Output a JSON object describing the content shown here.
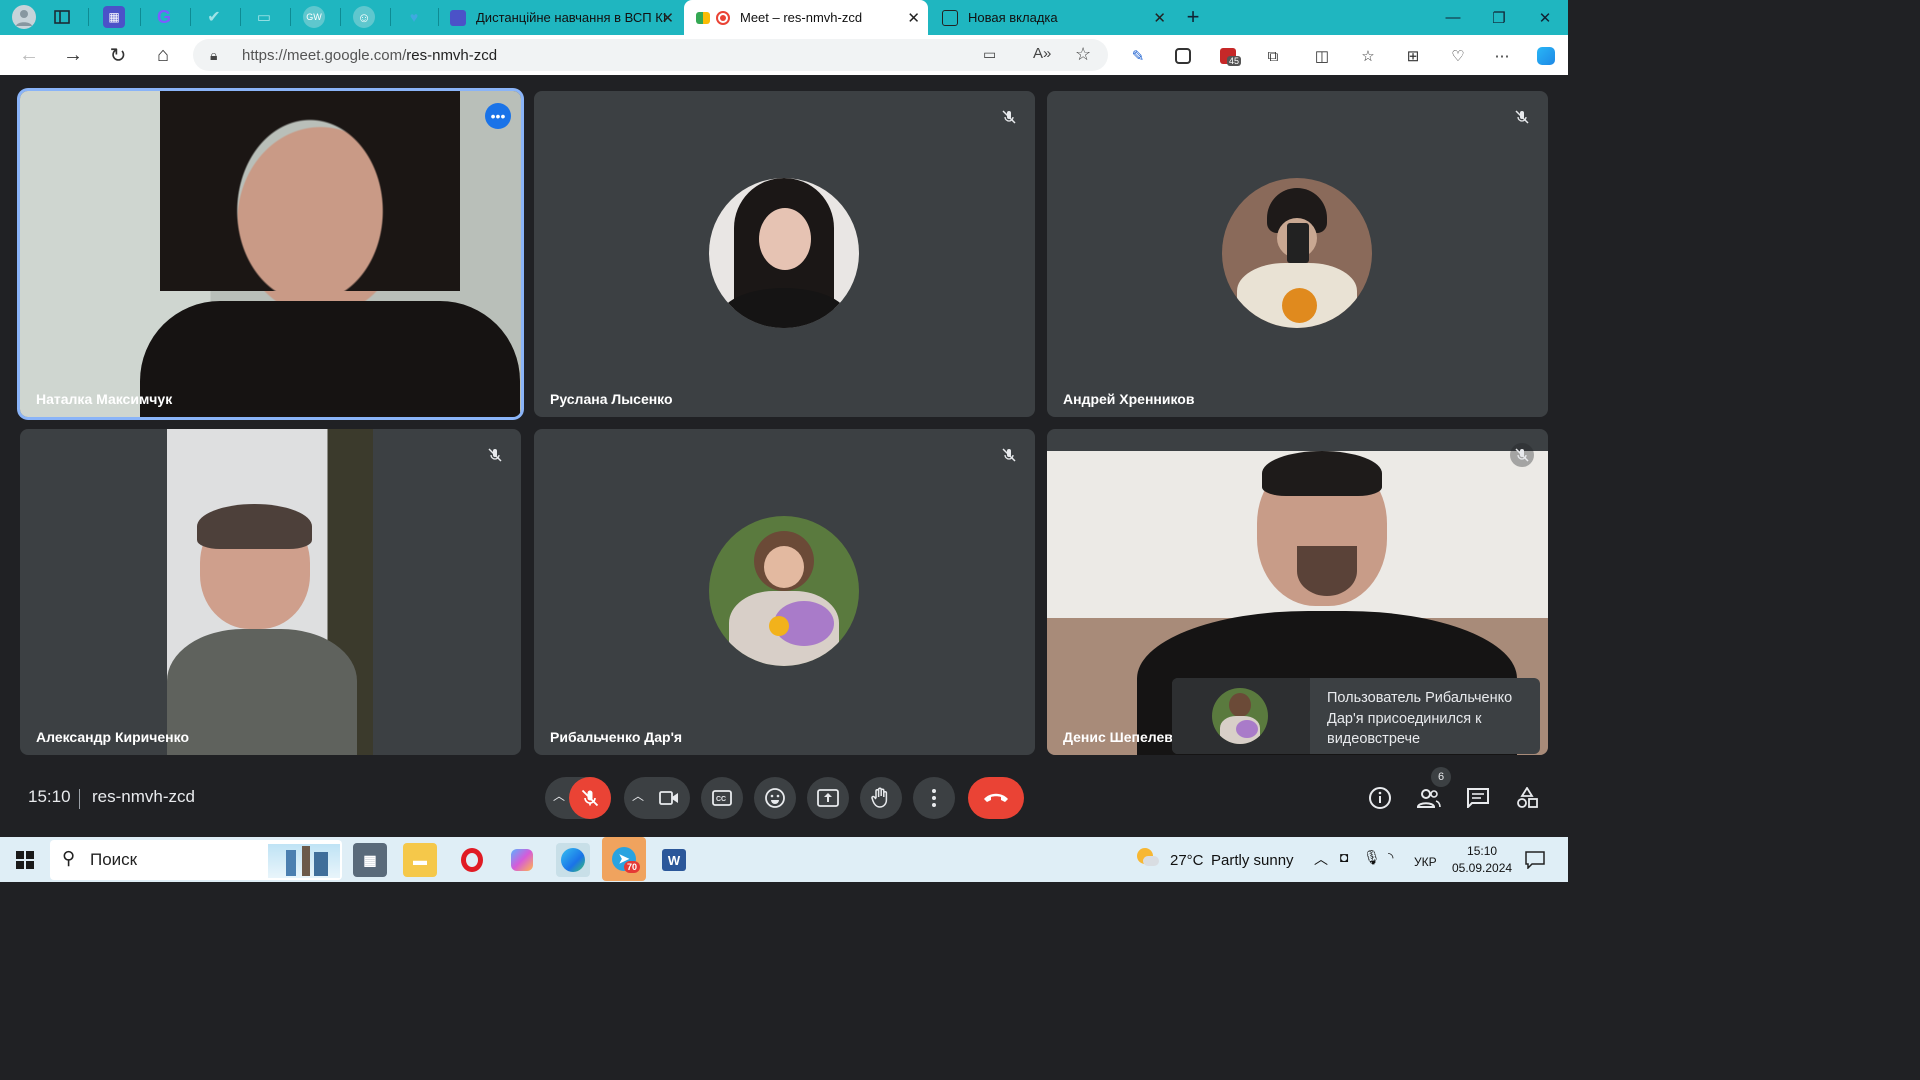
{
  "browser": {
    "tabs": [
      {
        "title": "Дистанційне навчання в ВСП КІ",
        "active": false
      },
      {
        "title": "Meet – res-nmvh-zcd",
        "active": true
      },
      {
        "title": "Новая вкладка",
        "active": false
      }
    ],
    "url_host": "https://meet.google.com/",
    "url_path": "res-nmvh-zcd",
    "tab_count_badge": "45",
    "pinned_icons": [
      "profile-icon",
      "tab-actions-icon",
      "forms-icon",
      "g-icon",
      "check-icon",
      "chat-icon",
      "gw-icon",
      "face-icon",
      "bird-icon"
    ],
    "extensions": [
      "camera-icon",
      "read-aloud-icon",
      "favorite-star-icon",
      "pen-icon",
      "instagram-icon",
      "adblock-icon",
      "puzzle-icon",
      "split-screen-icon",
      "favorites-icon",
      "collections-icon",
      "heart-icon",
      "more-icon",
      "copilot-icon"
    ]
  },
  "meeting": {
    "participants": [
      {
        "name": "Наталка Максимчук",
        "muted": false,
        "active_speaker": true
      },
      {
        "name": "Руслана Лысенко",
        "muted": true
      },
      {
        "name": "Андрей Хренников",
        "muted": true
      },
      {
        "name": "Александр Кириченко",
        "muted": true
      },
      {
        "name": "Рибальченко Дар'я",
        "muted": true
      },
      {
        "name": "Денис Шепелев",
        "muted": true
      }
    ],
    "toast": "Пользователь Рибальченко Дар'я присоединился к видеовстрече",
    "time": "15:10",
    "code": "res-nmvh-zcd",
    "people_count": "6",
    "colors": {
      "accent_blue": "#8ab4f8",
      "danger_red": "#ea4335",
      "tile_bg": "#3c4043",
      "bg": "#202124"
    }
  },
  "taskbar": {
    "search_placeholder": "Поиск",
    "telegram_badge": "70",
    "weather_temp": "27°C",
    "weather_desc": "Partly sunny",
    "language": "УКР",
    "clock_time": "15:10",
    "clock_date": "05.09.2024"
  }
}
